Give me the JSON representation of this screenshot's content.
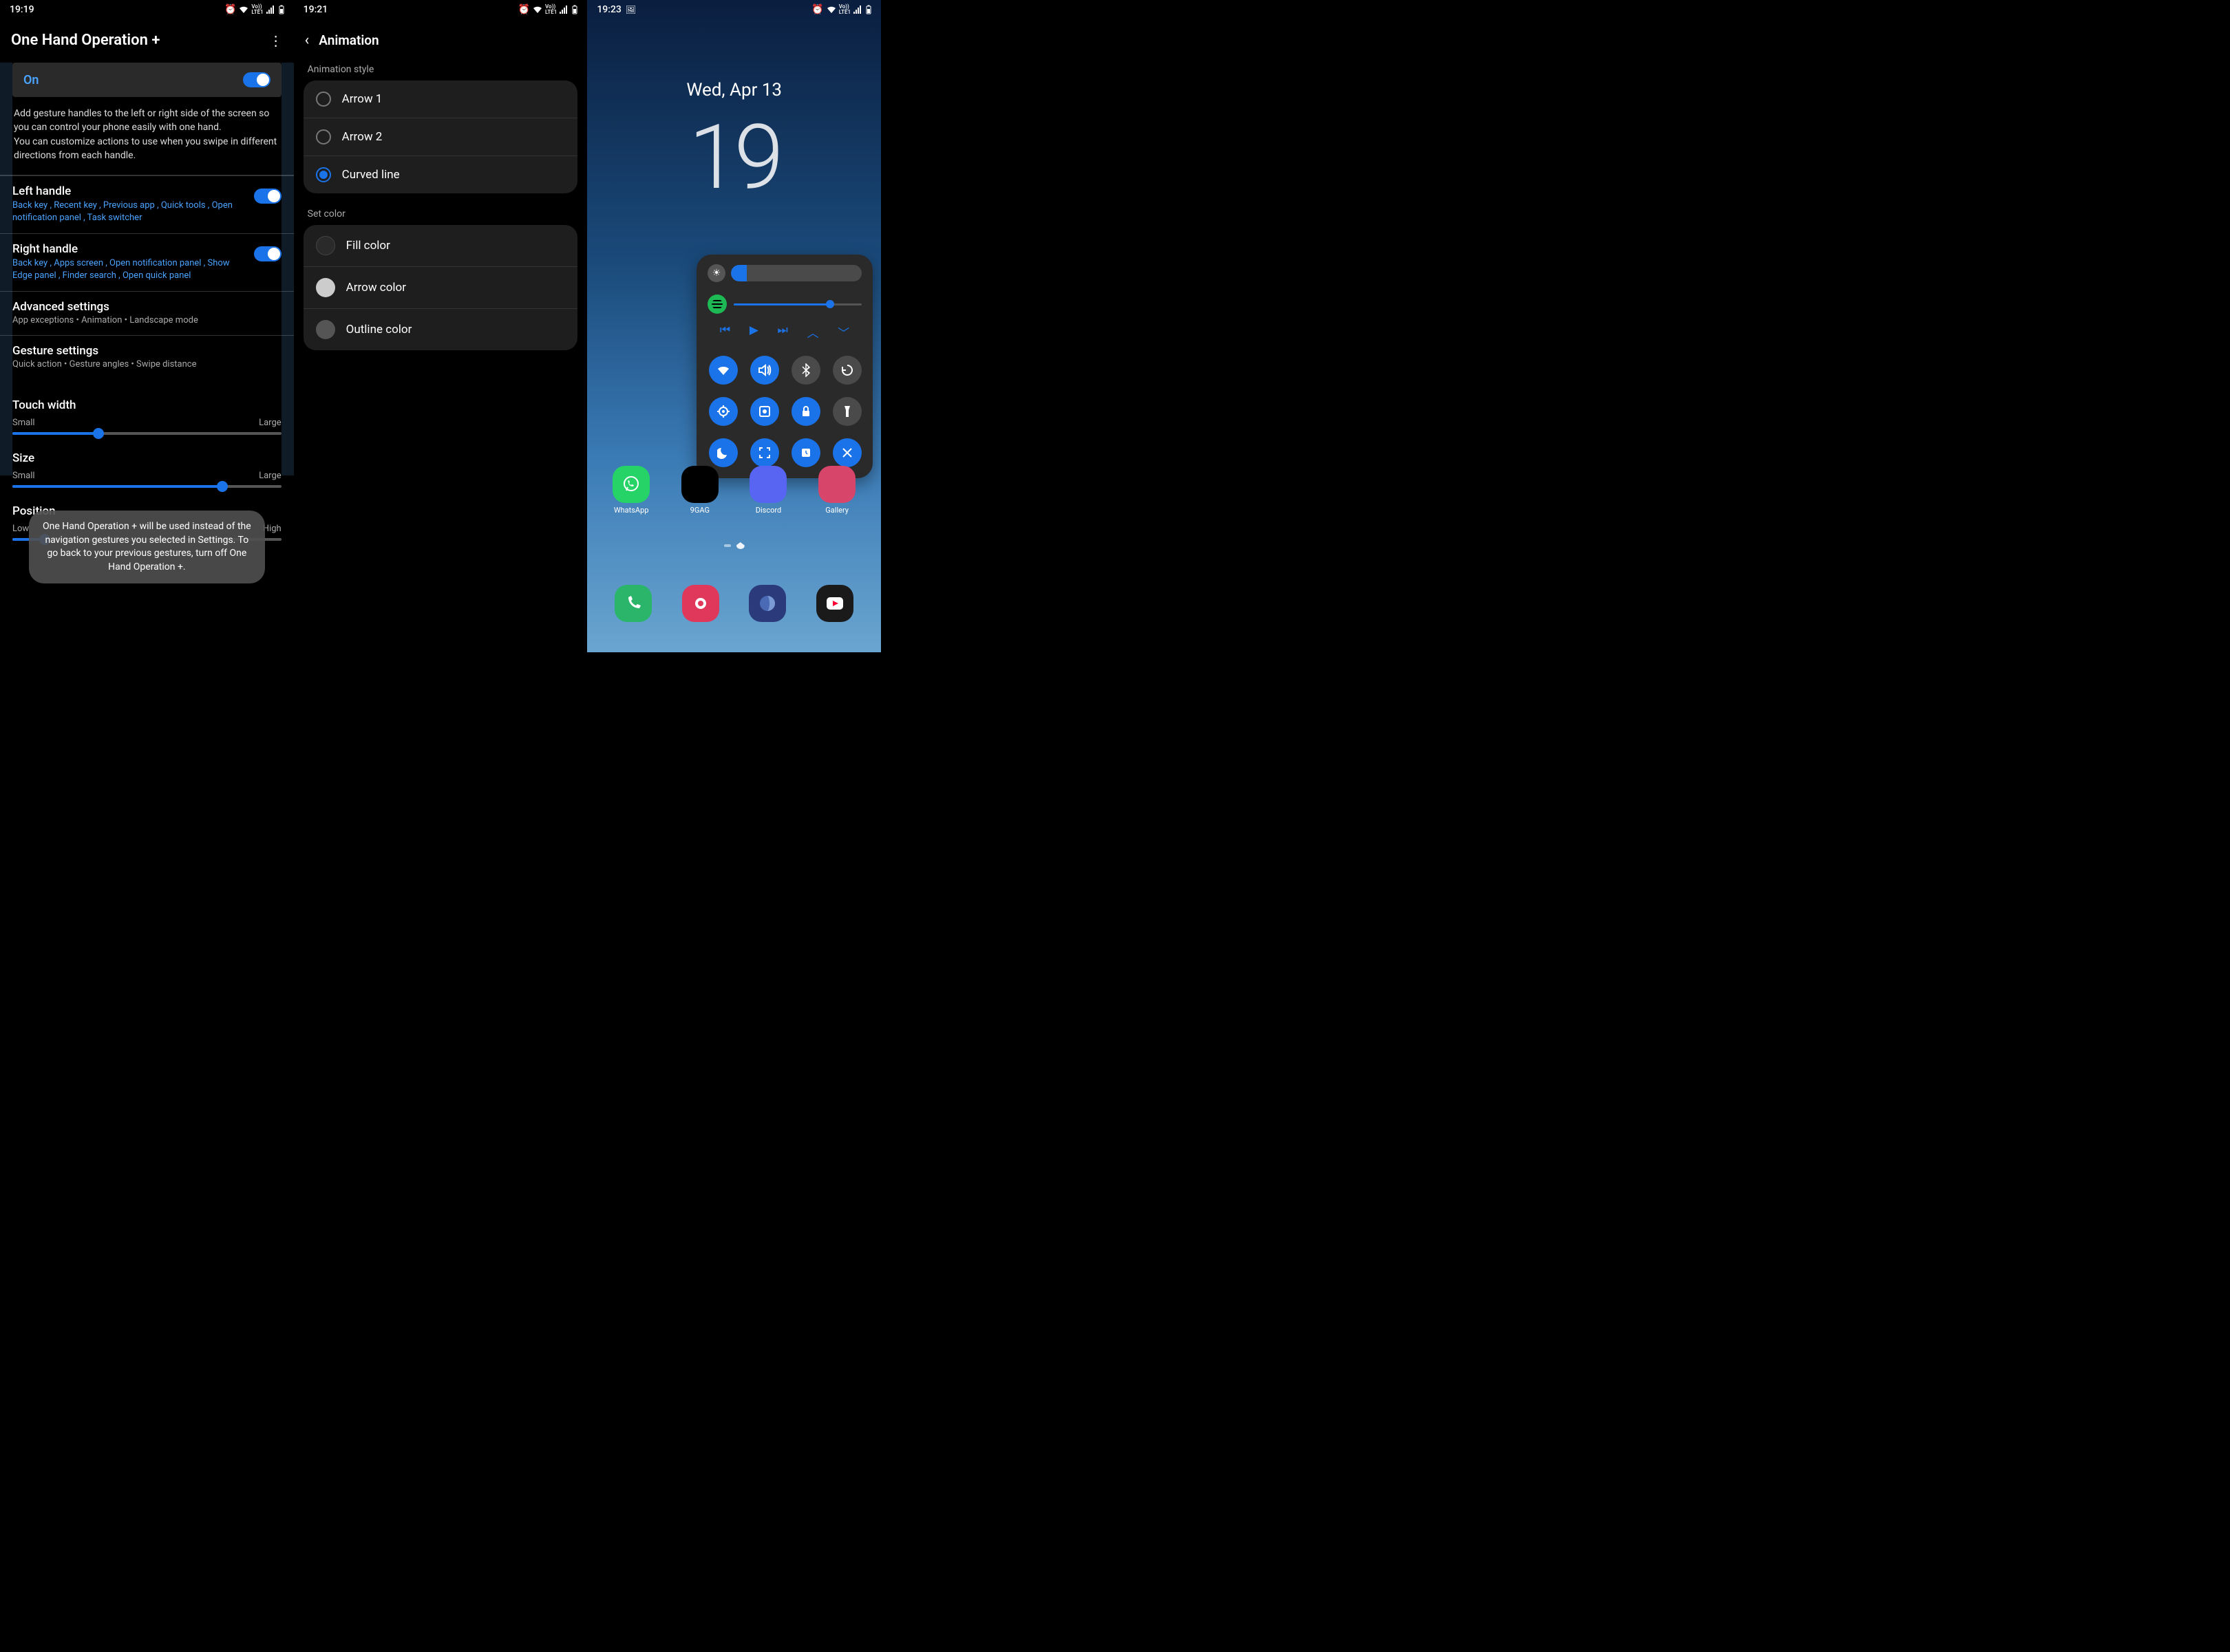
{
  "screen1": {
    "status": {
      "time": "19:19"
    },
    "title": "One Hand Operation +",
    "on_label": "On",
    "description": "Add gesture handles to the left or right side of the screen so you can control your phone easily with one hand.\nYou can customize actions to use when you swipe in different directions from each handle.",
    "left_handle": {
      "title": "Left handle",
      "sub": "Back key , Recent key , Previous app , Quick tools , Open notification panel , Task switcher"
    },
    "right_handle": {
      "title": "Right handle",
      "sub": "Back key , Apps screen , Open notification panel , Show Edge panel , Finder search , Open quick panel"
    },
    "advanced": {
      "title": "Advanced settings",
      "sub": "App exceptions • Animation • Landscape mode"
    },
    "gesture": {
      "title": "Gesture settings",
      "sub": "Quick action • Gesture angles • Swipe distance"
    },
    "touch_width": {
      "title": "Touch width",
      "low": "Small",
      "high": "Large",
      "value_pct": 32
    },
    "size": {
      "title": "Size",
      "low": "Small",
      "high": "Large",
      "value_pct": 78
    },
    "position": {
      "title": "Position",
      "low": "Low",
      "high": "High",
      "value_pct": 12
    },
    "toast": "One Hand Operation + will be used instead of the navigation gestures you selected in Settings. To go back to your previous gestures, turn off One Hand Operation +."
  },
  "screen2": {
    "status": {
      "time": "19:21"
    },
    "title": "Animation",
    "style_label": "Animation style",
    "styles": [
      {
        "label": "Arrow 1",
        "checked": false
      },
      {
        "label": "Arrow 2",
        "checked": false
      },
      {
        "label": "Curved line",
        "checked": true
      }
    ],
    "color_label": "Set color",
    "colors": [
      {
        "label": "Fill color",
        "hex": "#2a2a2a"
      },
      {
        "label": "Arrow color",
        "hex": "#cccccc"
      },
      {
        "label": "Outline color",
        "hex": "#555555"
      }
    ]
  },
  "screen3": {
    "status": {
      "time": "19:23"
    },
    "date": "Wed, Apr 13",
    "clock": "19",
    "brightness_pct": 12,
    "media_progress_pct": 75,
    "toggles": [
      {
        "name": "wifi",
        "on": true,
        "glyph": "wifi"
      },
      {
        "name": "sound",
        "on": true,
        "glyph": "volume"
      },
      {
        "name": "bluetooth",
        "on": false,
        "glyph": "bt"
      },
      {
        "name": "rotate",
        "on": false,
        "glyph": "rotate"
      },
      {
        "name": "location",
        "on": true,
        "glyph": "loc"
      },
      {
        "name": "screenrec",
        "on": true,
        "glyph": "rec"
      },
      {
        "name": "lock",
        "on": true,
        "glyph": "lock"
      },
      {
        "name": "flashlight",
        "on": false,
        "glyph": "flash"
      },
      {
        "name": "dnd",
        "on": true,
        "glyph": "moon"
      },
      {
        "name": "screenshot",
        "on": true,
        "glyph": "capture"
      },
      {
        "name": "clock",
        "on": true,
        "glyph": "clock"
      },
      {
        "name": "close",
        "on": true,
        "glyph": "close"
      }
    ],
    "apps": [
      {
        "label": "WhatsApp",
        "bg": "#25d366"
      },
      {
        "label": "9GAG",
        "bg": "#000"
      },
      {
        "label": "Discord",
        "bg": "#5865f2"
      },
      {
        "label": "Gallery",
        "bg": "#d8456a"
      }
    ],
    "dock": [
      {
        "name": "phone",
        "bg": "#2bb56a"
      },
      {
        "name": "camera",
        "bg": "#e0385a"
      },
      {
        "name": "browser",
        "bg": "#2a3a7a"
      },
      {
        "name": "youtube",
        "bg": "#1a1a1a"
      }
    ]
  }
}
